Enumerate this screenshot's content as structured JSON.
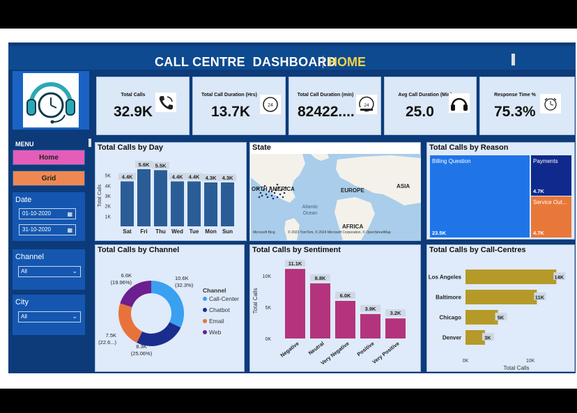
{
  "header": {
    "title": "CALL CENTRE  DASHBOARD",
    "page": "HOME"
  },
  "sidebar": {
    "menu_label": "MENU",
    "nav": [
      {
        "label": "Home"
      },
      {
        "label": "Grid"
      }
    ],
    "date": {
      "title": "Date",
      "start": "01-10-2020",
      "end": "31-10-2020"
    },
    "channel": {
      "title": "Channel",
      "value": "All"
    },
    "city": {
      "title": "City",
      "value": "All"
    }
  },
  "kpis": [
    {
      "label": "Total Calls",
      "value": "32.9K",
      "icon": "phone-icon"
    },
    {
      "label": "Total Call Duration (Hrs)",
      "value": "13.7K",
      "icon": "24-hours-icon"
    },
    {
      "label": "Total Call Duration (min)",
      "value": "82422....",
      "icon": "24-hours-clock-icon"
    },
    {
      "label": "Avg Call Duration (Min)",
      "value": "25.0",
      "icon": "headset-icon"
    },
    {
      "label": "Response Time %",
      "value": "75.3%",
      "icon": "alarm-clock-icon"
    }
  ],
  "charts": {
    "by_day": {
      "title": "Total Calls by Day"
    },
    "state": {
      "title": "State",
      "labels": {
        "na": "ORTH AMERICA",
        "europe": "EUROPE",
        "asia": "ASIA",
        "ocean": "Atlantic Ocean",
        "africa": "AFRICA"
      },
      "credit": "© 2023 TomTom, © 2024 Microsoft Corporation, © OpenStreetMap",
      "bing": "Microsoft Bing"
    },
    "by_reason": {
      "title": "Total Calls by Reason"
    },
    "by_channel": {
      "title": "Total Calls by Channel",
      "legend_title": "Channel"
    },
    "by_sentiment": {
      "title": "Total Calls by Sentiment"
    },
    "by_centre": {
      "title": "Total Calls by Call-Centres"
    }
  },
  "colors": {
    "bar_blue": "#2a5d96",
    "magenta": "#b3347c",
    "gold": "#b59a2a",
    "treemap_blue": "#1f75e8",
    "treemap_navy": "#10298c",
    "treemap_orange": "#e8783a",
    "donut": [
      "#3aa0f0",
      "#1a2d8e",
      "#e8733a",
      "#6c1f8e"
    ]
  },
  "chart_data": [
    {
      "type": "bar",
      "title": "Total Calls by Day",
      "categories": [
        "Sat",
        "Fri",
        "Thu",
        "Wed",
        "Tue",
        "Mon",
        "Sun"
      ],
      "values": [
        4400,
        5600,
        5500,
        4400,
        4400,
        4300,
        4300
      ],
      "labels": [
        "4.4K",
        "5.6K",
        "5.5K",
        "4.4K",
        "4.4K",
        "4.3K",
        "4.3K"
      ],
      "ylabel": "Total Calls",
      "yticks": [
        "1K",
        "2K",
        "3K",
        "4K",
        "5K"
      ],
      "ylim": [
        0,
        6000
      ]
    },
    {
      "type": "treemap",
      "title": "Total Calls by Reason",
      "categories": [
        "Billing Question",
        "Payments",
        "Service Out..."
      ],
      "values": [
        23500,
        4700,
        4700
      ],
      "labels": [
        "23.5K",
        "4.7K",
        "4.7K"
      ]
    },
    {
      "type": "pie",
      "title": "Total Calls by Channel",
      "legend_title": "Channel",
      "categories": [
        "Call-Center",
        "Chatbot",
        "Email",
        "Web"
      ],
      "values": [
        10600,
        8300,
        7500,
        6600
      ],
      "labels": [
        "10.6K",
        "8.3K",
        "7.5K",
        "6.6K"
      ],
      "percents": [
        "(32.3%)",
        "(25.06%)",
        "(22.6...)",
        "(19.96%)"
      ]
    },
    {
      "type": "bar",
      "title": "Total Calls by Sentiment",
      "categories": [
        "Negative",
        "Neutral",
        "Very Negative",
        "Positive",
        "Very Positive"
      ],
      "values": [
        11100,
        8800,
        6000,
        3900,
        3200
      ],
      "labels": [
        "11.1K",
        "8.8K",
        "6.0K",
        "3.9K",
        "3.2K"
      ],
      "ylabel": "Total Calls",
      "yticks": [
        "0K",
        "5K",
        "10K"
      ],
      "ylim": [
        0,
        12000
      ]
    },
    {
      "type": "bar",
      "orientation": "horizontal",
      "title": "Total Calls by Call-Centres",
      "categories": [
        "Los Angeles",
        "Baltimore",
        "Chicago",
        "Denver"
      ],
      "values": [
        14000,
        11000,
        5000,
        3000
      ],
      "labels": [
        "14K",
        "11K",
        "5K",
        "3K"
      ],
      "xlabel": "Total Calls",
      "xticks": [
        "0K",
        "10K"
      ],
      "xlim": [
        0,
        14500
      ]
    }
  ]
}
